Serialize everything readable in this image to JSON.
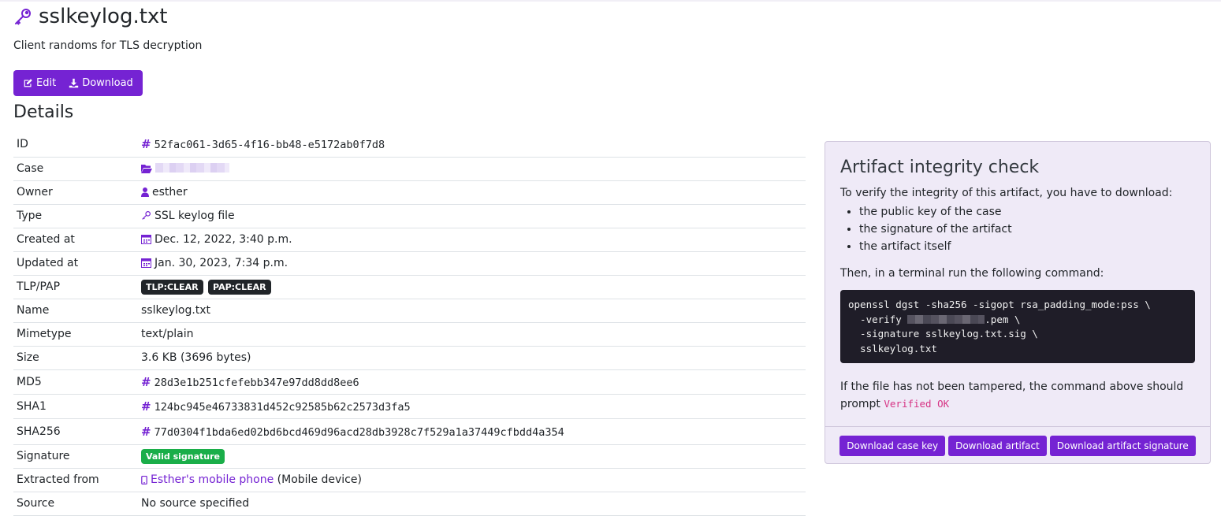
{
  "header": {
    "title": "sslkeylog.txt",
    "subtitle": "Client randoms for TLS decryption",
    "icon": "key-icon"
  },
  "actions": {
    "edit_label": "Edit",
    "download_label": "Download"
  },
  "details": {
    "heading": "Details",
    "rows": {
      "id": {
        "label": "ID",
        "value": "52fac061-3d65-4f16-bb48-e5172ab0f7d8"
      },
      "case": {
        "label": "Case"
      },
      "owner": {
        "label": "Owner",
        "value": "esther"
      },
      "type": {
        "label": "Type",
        "value": "SSL keylog file"
      },
      "created": {
        "label": "Created at",
        "value": "Dec. 12, 2022, 3:40 p.m."
      },
      "updated": {
        "label": "Updated at",
        "value": "Jan. 30, 2023, 7:34 p.m."
      },
      "tlp": {
        "label": "TLP/PAP",
        "tlp": "TLP:CLEAR",
        "pap": "PAP:CLEAR"
      },
      "name": {
        "label": "Name",
        "value": "sslkeylog.txt"
      },
      "mimetype": {
        "label": "Mimetype",
        "value": "text/plain"
      },
      "size": {
        "label": "Size",
        "value": "3.6 KB (3696 bytes)"
      },
      "md5": {
        "label": "MD5",
        "value": "28d3e1b251cfefebb347e97dd8dd8ee6"
      },
      "sha1": {
        "label": "SHA1",
        "value": "124bc945e46733831d452c92585b62c2573d3fa5"
      },
      "sha256": {
        "label": "SHA256",
        "value": "77d0304f1bda6ed02bd6bcd469d96acd28db3928c7f529a1a37449cfbdd4a354"
      },
      "signature": {
        "label": "Signature",
        "value": "Valid signature"
      },
      "extracted": {
        "label": "Extracted from",
        "link": "Esther's mobile phone",
        "suffix": "(Mobile device)"
      },
      "source": {
        "label": "Source",
        "value": "No source specified"
      }
    }
  },
  "integrity": {
    "heading": "Artifact integrity check",
    "intro": "To verify the integrity of this artifact, you have to download:",
    "items": [
      "the public key of the case",
      "the signature of the artifact",
      "the artifact itself"
    ],
    "then": "Then, in a terminal run the following command:",
    "code": {
      "line1": "openssl dgst -sha256 -sigopt rsa_padding_mode:pss \\",
      "line2_prefix": "  -verify ",
      "line2_suffix": ".pem \\",
      "line3": "  -signature sslkeylog.txt.sig \\",
      "line4": "  sslkeylog.txt"
    },
    "outro": "If the file has not been tampered, the command above should prompt",
    "verified": "Verified OK",
    "buttons": {
      "case_key": "Download case key",
      "artifact": "Download artifact",
      "signature": "Download artifact signature"
    }
  },
  "colors": {
    "accent": "#7523d3",
    "panel_bg": "#efeaf7",
    "code_bg": "#1f1d28",
    "valid_green": "#1aae49"
  }
}
